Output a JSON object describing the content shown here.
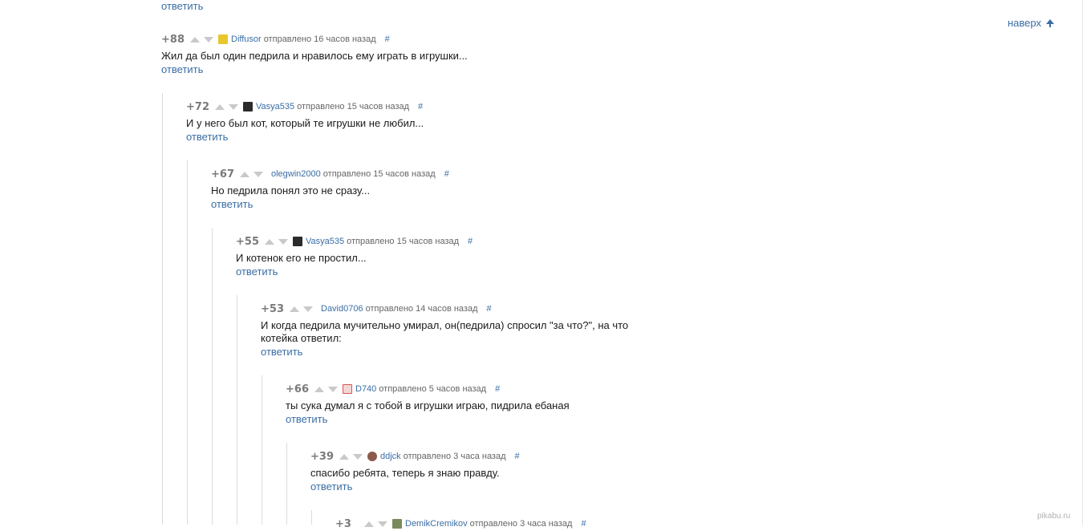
{
  "top_reply_label": "ответить",
  "to_top_label": "наверх",
  "watermark": "pikabu.ru",
  "colors": {
    "link": "#3a6ea5",
    "rating": "#7a7a7a",
    "thread_line": "#dcdcdc"
  },
  "comments": [
    {
      "rating": "+88",
      "author": "Diffusor",
      "meta": "отправлено 16 часов назад",
      "hash": "#",
      "text": "Жил да был один педрила и нравилось ему играть в игрушки...",
      "reply": "ответить",
      "avatar_icon": "yellow-face-avatar-icon"
    },
    {
      "rating": "+72",
      "author": "Vasya535",
      "meta": "отправлено 15 часов назад",
      "hash": "#",
      "text": "И у него был кот, который те игрушки не любил...",
      "reply": "ответить",
      "avatar_icon": "dark-portrait-avatar-icon"
    },
    {
      "rating": "+67",
      "author": "olegwin2000",
      "meta": "отправлено 15 часов назад",
      "hash": "#",
      "text": "Но педрила понял это не сразу...",
      "reply": "ответить",
      "avatar_icon": ""
    },
    {
      "rating": "+55",
      "author": "Vasya535",
      "meta": "отправлено 15 часов назад",
      "hash": "#",
      "text": "И котенок его не простил...",
      "reply": "ответить",
      "avatar_icon": "dark-portrait-avatar-icon"
    },
    {
      "rating": "+53",
      "author": "David0706",
      "meta": "отправлено 14 часов назад",
      "hash": "#",
      "text_line1": "И когда педрила мучительно умирал, он(педрила) спросил \"за что?\", на что",
      "text_line2": "котейка ответил:",
      "reply": "ответить",
      "avatar_icon": ""
    },
    {
      "rating": "+66",
      "author": "D740",
      "meta": "отправлено 5 часов назад",
      "hash": "#",
      "text": "ты сука думал я с тобой в игрушки играю, пидрила ебаная",
      "reply": "ответить",
      "avatar_icon": "red-figure-avatar-icon"
    },
    {
      "rating": "+39",
      "author": "ddjck",
      "meta": "отправлено 3 часа назад",
      "hash": "#",
      "text": "спасибо ребята, теперь я знаю правду.",
      "reply": "ответить",
      "avatar_icon": "face-avatar-icon"
    },
    {
      "rating": "+3",
      "author": "DemikCremikov",
      "meta": "отправлено 3 часа назад",
      "hash": "#",
      "avatar_icon": "cat-avatar-icon"
    }
  ]
}
